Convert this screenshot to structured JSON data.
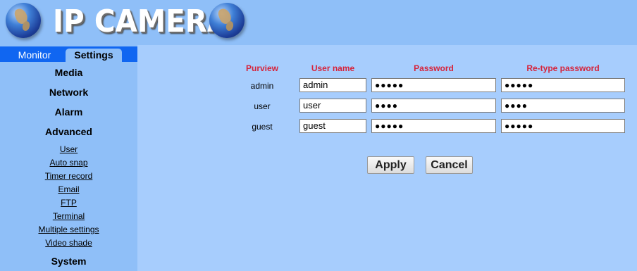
{
  "header": {
    "title": "IP CAMERA",
    "left_icon": "globe-icon",
    "right_icon": "globe-icon"
  },
  "sidebar": {
    "tabs": [
      {
        "label": "Monitor"
      },
      {
        "label": "Settings"
      }
    ],
    "sections": {
      "media": "Media",
      "network": "Network",
      "alarm": "Alarm",
      "advanced": "Advanced",
      "system": "System"
    },
    "advanced_items": [
      "User",
      "Auto snap",
      "Timer record",
      "Email",
      "FTP",
      "Terminal",
      "Multiple settings",
      "Video shade"
    ]
  },
  "users_table": {
    "headers": {
      "purview": "Purview",
      "username": "User name",
      "password": "Password",
      "retype": "Re-type password"
    },
    "rows": [
      {
        "purview": "admin",
        "username": "admin",
        "password": "●●●●●",
        "retype": "●●●●●"
      },
      {
        "purview": "user",
        "username": "user",
        "password": "●●●●",
        "retype": "●●●●"
      },
      {
        "purview": "guest",
        "username": "guest",
        "password": "●●●●●",
        "retype": "●●●●●"
      }
    ]
  },
  "actions": {
    "apply": "Apply",
    "cancel": "Cancel"
  },
  "colors": {
    "header_bg": "#8fbff8",
    "tab_bar": "#1066f1",
    "content_bg": "#a7cdfd",
    "column_header": "#d6233a"
  }
}
